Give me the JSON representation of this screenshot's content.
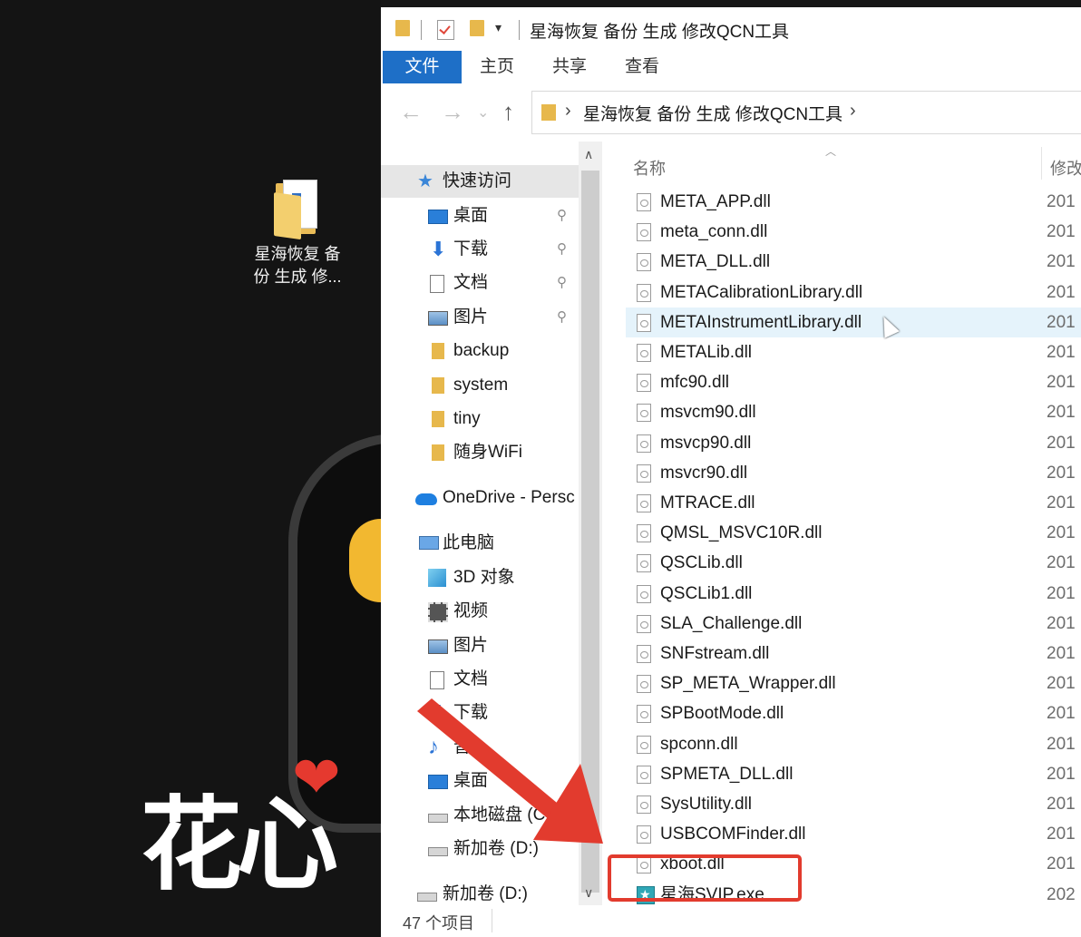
{
  "desktop": {
    "folder_label_line1": "星海恢复 备",
    "folder_label_line2": "份 生成 修...",
    "brand_text": "花心",
    "heart": "❤"
  },
  "window": {
    "title": "星海恢复 备份 生成 修改QCN工具"
  },
  "ribbon": {
    "tabs": [
      "文件",
      "主页",
      "共享",
      "查看"
    ]
  },
  "address_bar": {
    "path": "星海恢复 备份 生成 修改QCN工具",
    "back": "←",
    "forward": "→",
    "recent": "⌄",
    "up": "↑",
    "chevron": "›"
  },
  "nav_pane": {
    "quick_access": "快速访问",
    "items": [
      {
        "label": "桌面",
        "icon": "desktop-icon",
        "pinned": true
      },
      {
        "label": "下载",
        "icon": "download-icon",
        "pinned": true
      },
      {
        "label": "文档",
        "icon": "document-icon",
        "pinned": true
      },
      {
        "label": "图片",
        "icon": "picture-icon",
        "pinned": true
      },
      {
        "label": "backup",
        "icon": "folder-icon",
        "pinned": false
      },
      {
        "label": "system",
        "icon": "folder-icon",
        "pinned": false
      },
      {
        "label": "tiny",
        "icon": "folder-icon",
        "pinned": false
      },
      {
        "label": "随身WiFi",
        "icon": "folder-icon",
        "pinned": false
      }
    ],
    "onedrive": "OneDrive - Persc",
    "this_pc": "此电脑",
    "pc_items": [
      {
        "label": "3D 对象",
        "icon": "3d-objects-icon"
      },
      {
        "label": "视频",
        "icon": "video-icon"
      },
      {
        "label": "图片",
        "icon": "picture-icon"
      },
      {
        "label": "文档",
        "icon": "document-icon"
      },
      {
        "label": "下载",
        "icon": "download-icon"
      },
      {
        "label": "音",
        "icon": "music-icon"
      },
      {
        "label": "桌面",
        "icon": "desktop-icon"
      },
      {
        "label": "本地磁盘 (C",
        "icon": "disk-icon"
      },
      {
        "label": "新加卷 (D:)",
        "icon": "disk-icon"
      }
    ],
    "network_drive": "新加卷 (D:)",
    "pin_glyph": "📌"
  },
  "file_list": {
    "col_name": "名称",
    "col_modified": "修改",
    "files": [
      {
        "name": "META_APP.dll",
        "date": "201"
      },
      {
        "name": "meta_conn.dll",
        "date": "201"
      },
      {
        "name": "META_DLL.dll",
        "date": "201"
      },
      {
        "name": "METACalibrationLibrary.dll",
        "date": "201"
      },
      {
        "name": "METAInstrumentLibrary.dll",
        "date": "201"
      },
      {
        "name": "METALib.dll",
        "date": "201"
      },
      {
        "name": "mfc90.dll",
        "date": "201"
      },
      {
        "name": "msvcm90.dll",
        "date": "201"
      },
      {
        "name": "msvcp90.dll",
        "date": "201"
      },
      {
        "name": "msvcr90.dll",
        "date": "201"
      },
      {
        "name": "MTRACE.dll",
        "date": "201"
      },
      {
        "name": "QMSL_MSVC10R.dll",
        "date": "201"
      },
      {
        "name": "QSCLib.dll",
        "date": "201"
      },
      {
        "name": "QSCLib1.dll",
        "date": "201"
      },
      {
        "name": "SLA_Challenge.dll",
        "date": "201"
      },
      {
        "name": "SNFstream.dll",
        "date": "201"
      },
      {
        "name": "SP_META_Wrapper.dll",
        "date": "201"
      },
      {
        "name": "SPBootMode.dll",
        "date": "201"
      },
      {
        "name": "spconn.dll",
        "date": "201"
      },
      {
        "name": "SPMETA_DLL.dll",
        "date": "201"
      },
      {
        "name": "SysUtility.dll",
        "date": "201"
      },
      {
        "name": "USBCOMFinder.dll",
        "date": "201"
      },
      {
        "name": "xboot.dll",
        "date": "201"
      },
      {
        "name": "星海SVIP.exe",
        "date": "202"
      }
    ]
  },
  "status_bar": {
    "item_count": "47 个项目"
  },
  "colors": {
    "accent": "#1e6fc7",
    "highlight": "#e23b2e",
    "folder": "#e7b84c"
  }
}
